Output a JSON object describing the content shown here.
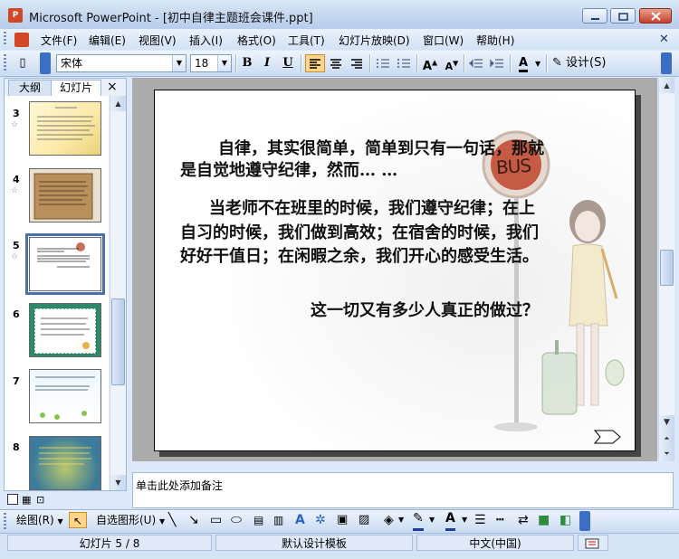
{
  "window": {
    "app_icon_text": "P",
    "title": "Microsoft PowerPoint - [初中自律主题班会课件.ppt]"
  },
  "menu": {
    "items": [
      "文件(F)",
      "编辑(E)",
      "视图(V)",
      "插入(I)",
      "格式(O)",
      "工具(T)",
      "幻灯片放映(D)",
      "窗口(W)",
      "帮助(H)"
    ]
  },
  "toolbar": {
    "font_name": "宋体",
    "font_size": "18",
    "bold": "B",
    "italic": "I",
    "underline": "U",
    "design_label": "设计(S)"
  },
  "left_pane": {
    "tab_outline": "大纲",
    "tab_slides": "幻灯片",
    "close": "×",
    "slides": [
      {
        "num": "3"
      },
      {
        "num": "4"
      },
      {
        "num": "5",
        "selected": true
      },
      {
        "num": "6"
      },
      {
        "num": "7"
      },
      {
        "num": "8"
      }
    ]
  },
  "slide": {
    "para1_line1": "自律，其实很简单，简单到只有一句话，那就",
    "para1_line2": "是自觉地遵守纪律，然而…  …",
    "para2_line1": "当老师不在班里的时候，我们遵守纪律；在上",
    "para2_line2": "自习的时候，我们做到高效；在宿舍的时候，我们",
    "para2_line3": "好好干值日；在闲暇之余，我们开心的感受生活。",
    "question": "这一切又有多少人真正的做过？",
    "bus_sign": "BUS"
  },
  "notes": {
    "placeholder": "单击此处添加备注"
  },
  "drawing_toolbar": {
    "draw_label": "绘图(R)",
    "autoshapes_label": "自选图形(U)"
  },
  "status": {
    "slide_indicator": "幻灯片 5 / 8",
    "template": "默认设计模板",
    "language": "中文(中国)"
  }
}
